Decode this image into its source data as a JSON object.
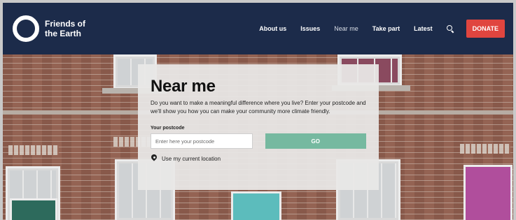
{
  "brand": {
    "name": "Friends of the Earth"
  },
  "nav": {
    "items": [
      {
        "label": "About us",
        "active": false
      },
      {
        "label": "Issues",
        "active": false
      },
      {
        "label": "Near me",
        "active": true
      },
      {
        "label": "Take part",
        "active": false
      },
      {
        "label": "Latest",
        "active": false
      }
    ],
    "search_icon": "search-icon",
    "donate_label": "DONATE"
  },
  "near_me": {
    "title": "Near me",
    "description": "Do you want to make a meaningful difference where you live? Enter your postcode and we'll show you how you can make your community more climate friendly.",
    "postcode_label": "Your postcode",
    "postcode_placeholder": "Enter here your postcode",
    "postcode_value": "",
    "go_label": "GO",
    "location_label": "Use my current location",
    "location_icon": "map-pin-icon"
  },
  "colors": {
    "header_bg": "#1c2b4a",
    "donate_bg": "#e0453f",
    "go_bg": "#76b9a0"
  }
}
